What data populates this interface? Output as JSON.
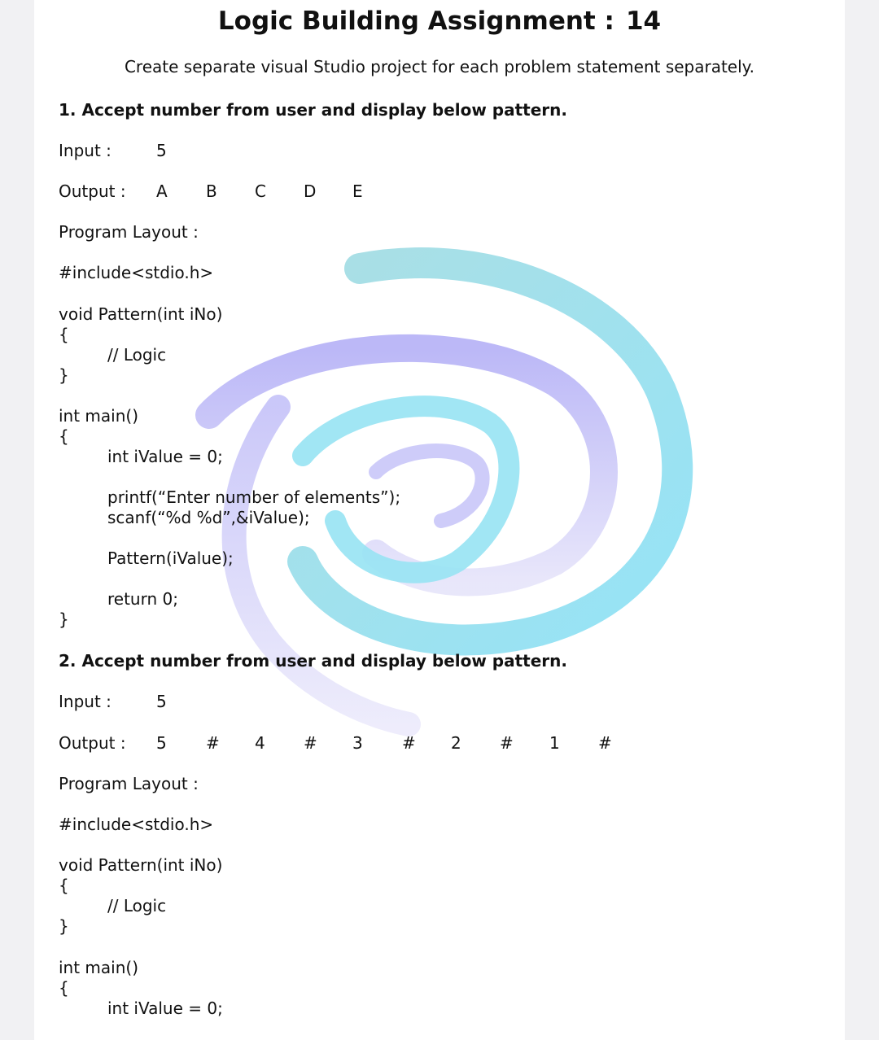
{
  "title": "Logic Building Assignment :",
  "title_number": "14",
  "subtitle": "Create separate visual Studio project for each problem statement separately.",
  "problems": [
    {
      "heading": "1. Accept number from user and display below pattern.",
      "input_label": "Input :",
      "input_value": "5",
      "output_label": "Output :",
      "output_tokens": [
        "A",
        "B",
        "C",
        "D",
        "E"
      ],
      "layout_label": "Program Layout :",
      "include_line": "#include<stdio.h>",
      "func_sig": "void Pattern(int iNo)",
      "open_brace": "{",
      "logic_comment": "// Logic",
      "close_brace": "}",
      "main_sig": "int main()",
      "main_open": "{",
      "decl": "int iValue = 0;",
      "printf_line": "printf(“Enter number of elements”);",
      "scanf_line": "scanf(“%d %d”,&iValue);",
      "call_line": "Pattern(iValue);",
      "return_line": "return 0;",
      "main_close": "}"
    },
    {
      "heading": "2. Accept number from user and display below pattern.",
      "input_label": "Input :",
      "input_value": "5",
      "output_label": "Output :",
      "output_tokens": [
        "5",
        "#",
        "4",
        "#",
        "3",
        "#",
        "2",
        "#",
        "1",
        "#"
      ],
      "layout_label": "Program Layout :",
      "include_line": "#include<stdio.h>",
      "func_sig": "void Pattern(int iNo)",
      "open_brace": "{",
      "logic_comment": "// Logic",
      "close_brace": "}",
      "main_sig": "int main()",
      "main_open": "{",
      "decl": "int iValue = 0;"
    }
  ],
  "colors": {
    "swirl_cyan": "#8fdcef",
    "swirl_purple": "#b7b3f5"
  }
}
